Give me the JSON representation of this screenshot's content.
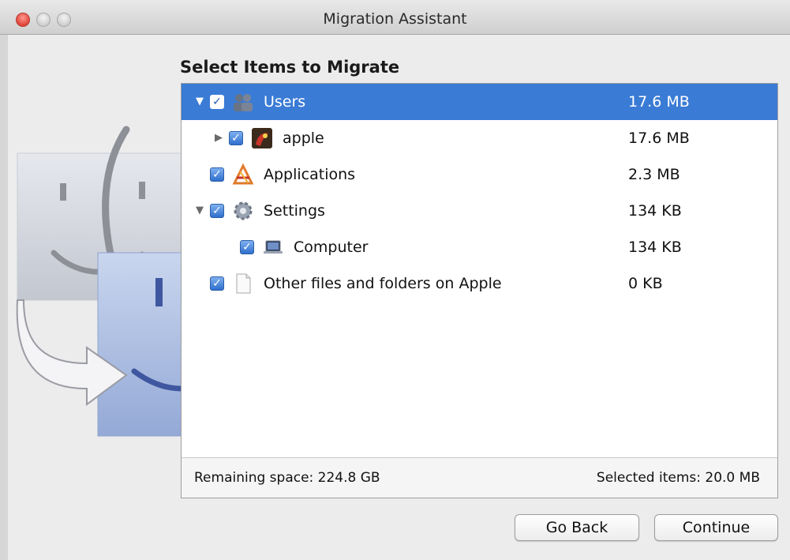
{
  "window": {
    "title": "Migration Assistant"
  },
  "heading": "Select Items to Migrate",
  "items": [
    {
      "name": "Users",
      "size": "17.6 MB",
      "checked": true,
      "expanded": true,
      "icon": "users-icon"
    },
    {
      "name": "apple",
      "size": "17.6 MB",
      "checked": true,
      "expanded": false,
      "icon": "user-avatar-icon"
    },
    {
      "name": "Applications",
      "size": "2.3 MB",
      "checked": true,
      "icon": "applications-icon"
    },
    {
      "name": "Settings",
      "size": "134 KB",
      "checked": true,
      "expanded": true,
      "icon": "gear-icon"
    },
    {
      "name": "Computer",
      "size": "134 KB",
      "checked": true,
      "icon": "laptop-icon"
    },
    {
      "name": "Other files and folders on Apple",
      "size": "0 KB",
      "checked": true,
      "icon": "document-icon"
    }
  ],
  "footer": {
    "remaining": "Remaining space: 224.8 GB",
    "selected": "Selected items: 20.0 MB"
  },
  "buttons": {
    "back": "Go Back",
    "continue": "Continue"
  },
  "colors": {
    "selection": "#3a7bd5",
    "checkbox": "#2f6fcd"
  }
}
